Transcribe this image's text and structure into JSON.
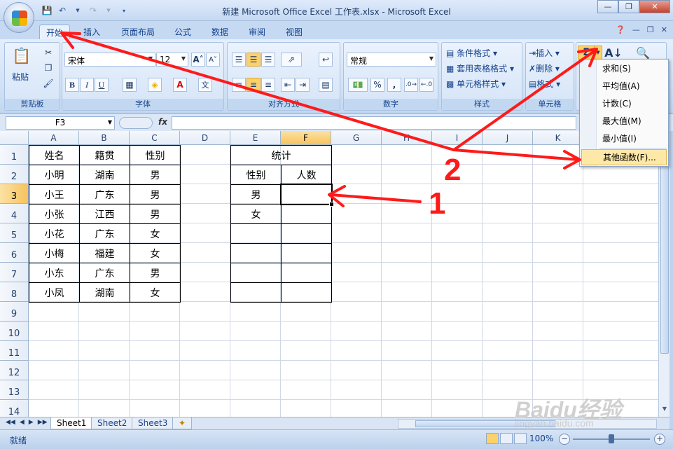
{
  "window": {
    "title": "新建 Microsoft Office Excel 工作表.xlsx - Microsoft Excel"
  },
  "tabs": [
    "开始",
    "插入",
    "页面布局",
    "公式",
    "数据",
    "审阅",
    "视图"
  ],
  "ribbon": {
    "clipboard": {
      "paste": "粘贴",
      "label": "剪贴板"
    },
    "font": {
      "name": "宋体",
      "size": "12",
      "label": "字体",
      "bold": "B",
      "italic": "I",
      "underline": "U",
      "wen": "文"
    },
    "alignment": {
      "label": "对齐方式"
    },
    "number": {
      "format": "常规",
      "label": "数字",
      "percent": "%",
      "comma": ","
    },
    "styles": {
      "conditional": "条件格式",
      "table": "套用表格格式",
      "cell": "单元格样式",
      "label": "样式"
    },
    "cells": {
      "insert": "插入",
      "delete": "删除",
      "format": "格式",
      "label": "单元格"
    },
    "editing": {
      "sigma": "Σ"
    }
  },
  "formula_bar": {
    "name_box": "F3",
    "fx": "fx",
    "content": ""
  },
  "columns": [
    "A",
    "B",
    "C",
    "D",
    "E",
    "F",
    "G",
    "H",
    "I",
    "J",
    "K"
  ],
  "active_cell": {
    "col": "F",
    "row": "3"
  },
  "rows": [
    "1",
    "2",
    "3",
    "4",
    "5",
    "6",
    "7",
    "8",
    "9",
    "10",
    "11",
    "12",
    "13",
    "14"
  ],
  "table_main": {
    "headers": [
      "姓名",
      "籍贯",
      "性别"
    ],
    "rows": [
      [
        "小明",
        "湖南",
        "男"
      ],
      [
        "小王",
        "广东",
        "男"
      ],
      [
        "小张",
        "江西",
        "男"
      ],
      [
        "小花",
        "广东",
        "女"
      ],
      [
        "小梅",
        "福建",
        "女"
      ],
      [
        "小东",
        "广东",
        "男"
      ],
      [
        "小凤",
        "湖南",
        "女"
      ]
    ]
  },
  "table_stats": {
    "title": "统计",
    "headers": [
      "性别",
      "人数"
    ],
    "rows": [
      [
        "男",
        ""
      ],
      [
        "女",
        ""
      ],
      [
        "",
        ""
      ],
      [
        "",
        ""
      ],
      [
        "",
        ""
      ],
      [
        "",
        ""
      ]
    ]
  },
  "autosum_menu": {
    "items": [
      "求和(S)",
      "平均值(A)",
      "计数(C)",
      "最大值(M)",
      "最小值(I)"
    ],
    "more": "其他函数(F)..."
  },
  "sheets": [
    "Sheet1",
    "Sheet2",
    "Sheet3"
  ],
  "status": {
    "ready": "就绪",
    "zoom": "100%",
    "minus": "−",
    "plus": "+"
  },
  "annotations": {
    "one": "1",
    "two": "2"
  },
  "watermark": {
    "brand": "Baidu经验",
    "url": "jingyan.baidu.com"
  },
  "colors": {
    "arrow": "#ff1a1a",
    "highlight": "#fbd26a",
    "ribbon": "#dbe7f6"
  }
}
